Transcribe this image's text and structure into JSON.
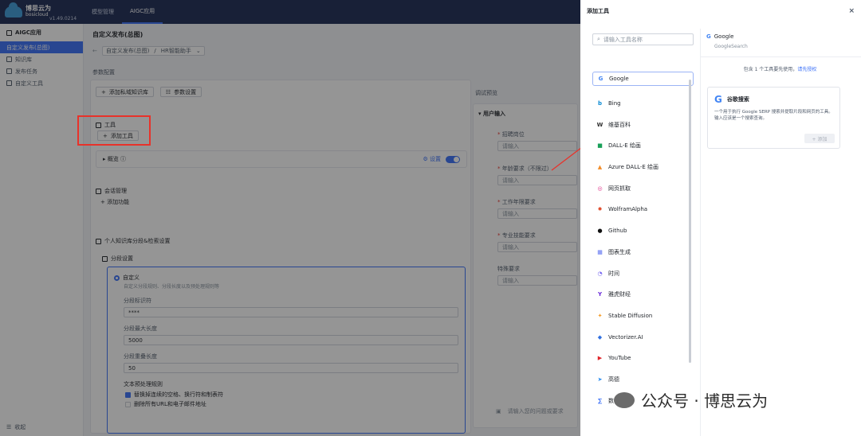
{
  "app": {
    "name_cn": "博思云为",
    "name_en": "bosicloud",
    "version": "v1.49.0214"
  },
  "topnav": [
    "模型管理",
    "AIGC应用"
  ],
  "sidebar": {
    "header": "AIGC应用",
    "items": [
      "自定义发布(总图)",
      "知识库",
      "发布任务",
      "自定义工具"
    ],
    "collapse": "收起"
  },
  "page": {
    "title": "自定义发布(总图)",
    "crumb1": "自定义发布(总图)",
    "crumb2": "HR智能助手",
    "param_config": "参数配置",
    "add_kb": "添加私域知识库",
    "param_settings": "参数设置",
    "tools_label": "工具",
    "add_tool": "添加工具",
    "summary": "概览",
    "settings": "设置",
    "session_mgmt": "会话管理",
    "add_function": "添加功能",
    "kb_split": "个人知识库分段&检索设置",
    "split_settings": "分段设置",
    "custom": "自定义",
    "custom_desc": "自定义分段规则、分段长度以及预处理规则等",
    "separator_label": "分段标识符",
    "separator_value": "****",
    "max_len_label": "分段最大长度",
    "max_len_value": "5000",
    "overlap_label": "分段重叠长度",
    "overlap_value": "50",
    "preprocess_label": "文本预处理规则",
    "rule1": "替换掉连续的空格、换行符和制表符",
    "rule2": "删除所有URL和电子邮件地址",
    "debug_preview": "调试预览",
    "user_input": "用户输入",
    "f1": "招聘岗位",
    "f2": "年龄要求（不限过）",
    "f3": "工作年限要求",
    "f4": "专业技能要求",
    "f5": "特殊要求",
    "placeholder": "请输入",
    "chat_placeholder": "请输入您的问题或要求"
  },
  "drawer": {
    "title": "添加工具",
    "close": "×",
    "search_placeholder": "请输入工具名称",
    "tools": [
      {
        "name": "Google",
        "icon": "G",
        "color": "#4285f4"
      },
      {
        "name": "Bing",
        "icon": "b",
        "color": "#0a8ad4"
      },
      {
        "name": "维基百科",
        "icon": "W",
        "color": "#333333"
      },
      {
        "name": "DALL-E 绘画",
        "icon": "■",
        "color": "#18a058"
      },
      {
        "name": "Azure DALL-E 绘画",
        "icon": "▲",
        "color": "#f28c28"
      },
      {
        "name": "网页抓取",
        "icon": "◎",
        "color": "#e0338a"
      },
      {
        "name": "WolframAlpha",
        "icon": "✹",
        "color": "#e04a2a"
      },
      {
        "name": "Github",
        "icon": "●",
        "color": "#111111"
      },
      {
        "name": "图表生成",
        "icon": "▦",
        "color": "#5a6ff0"
      },
      {
        "name": "时间",
        "icon": "◔",
        "color": "#6b5bf0"
      },
      {
        "name": "雅虎财经",
        "icon": "Y",
        "color": "#6a2bd9"
      },
      {
        "name": "Stable Diffusion",
        "icon": "✦",
        "color": "#f59a23"
      },
      {
        "name": "Vectorizer.AI",
        "icon": "◆",
        "color": "#2f6fe0"
      },
      {
        "name": "YouTube",
        "icon": "▶",
        "color": "#e0242a"
      },
      {
        "name": "高德",
        "icon": "➤",
        "color": "#2a8cf0"
      },
      {
        "name": "数学工具",
        "icon": "∑",
        "color": "#3a6ff7"
      }
    ],
    "detail": {
      "name": "Google",
      "sub": "GoogleSearch",
      "note_prefix": "包含 1 个工具要先使用，",
      "note_link": "请先授权",
      "func_name": "谷歌搜索",
      "func_desc": "一个用于执行 Google SERP 搜索并提取片段和网页的工具。输入应该是一个搜索查询。",
      "add_label": "+ 添加"
    }
  },
  "watermark": "公众号 · 博思云为",
  "colors": {
    "accent": "#3a6ff7",
    "topbar": "#1c2b55",
    "highlight": "#e8322a"
  }
}
